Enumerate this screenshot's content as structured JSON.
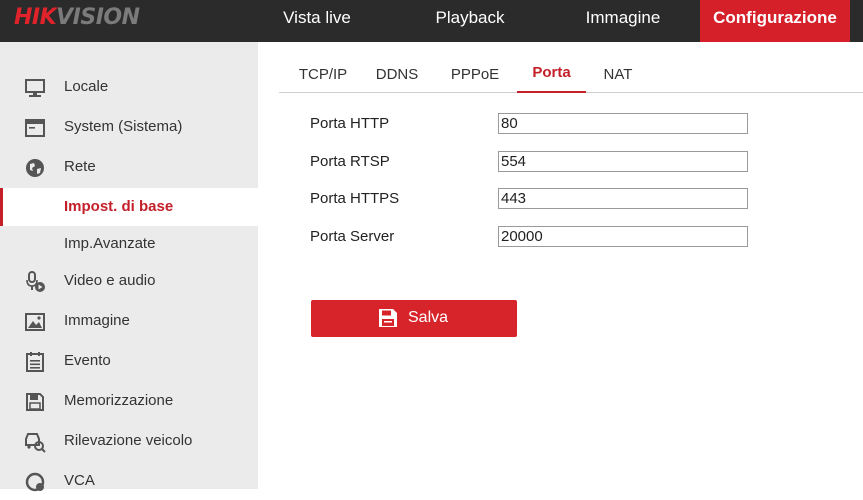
{
  "header": {
    "logo_hik": "HIK",
    "logo_vision": "VISION",
    "nav": [
      {
        "label": "Vista live"
      },
      {
        "label": "Playback"
      },
      {
        "label": "Immagine"
      },
      {
        "label": "Configurazione",
        "active": true
      }
    ]
  },
  "sidebar": {
    "items": [
      {
        "label": "Locale",
        "icon": "monitor-icon"
      },
      {
        "label": "System (Sistema)",
        "icon": "system-window-icon"
      },
      {
        "label": "Rete",
        "icon": "globe-icon"
      },
      {
        "label": "Impost. di base",
        "icon": "",
        "active": true
      },
      {
        "label": "Imp.Avanzate",
        "icon": ""
      },
      {
        "label": "Video e audio",
        "icon": "microphone-play-icon"
      },
      {
        "label": "Immagine",
        "icon": "image-icon"
      },
      {
        "label": "Evento",
        "icon": "calendar-list-icon"
      },
      {
        "label": "Memorizzazione",
        "icon": "floppy-disk-icon"
      },
      {
        "label": "Rilevazione veicolo",
        "icon": "vehicle-search-icon"
      },
      {
        "label": "VCA",
        "icon": "vca-icon"
      }
    ]
  },
  "tabs": [
    {
      "label": "TCP/IP"
    },
    {
      "label": "DDNS"
    },
    {
      "label": "PPPoE"
    },
    {
      "label": "Porta",
      "active": true
    },
    {
      "label": "NAT"
    }
  ],
  "form": {
    "rows": [
      {
        "label": "Porta HTTP",
        "value": "80"
      },
      {
        "label": "Porta RTSP",
        "value": "554"
      },
      {
        "label": "Porta HTTPS",
        "value": "443"
      },
      {
        "label": "Porta Server",
        "value": "20000"
      }
    ],
    "save_label": "Salva"
  },
  "colors": {
    "accent": "#d5202a",
    "topbar": "#2b2b2b",
    "sidebar": "#ebebeb"
  }
}
